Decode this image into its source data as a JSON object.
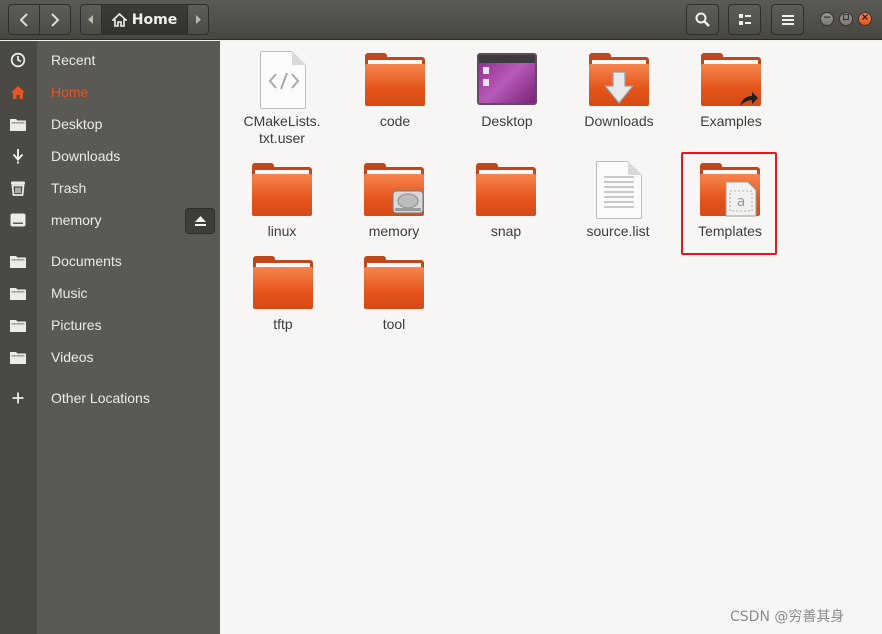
{
  "header": {
    "back_icon": "chevron-left-icon",
    "forward_icon": "chevron-right-icon",
    "path_label": "Home",
    "search_icon": "search-icon",
    "view_icon": "grid-view-icon",
    "menu_icon": "hamburger-menu-icon"
  },
  "sidebar": {
    "items": [
      {
        "label": "Recent",
        "icon": "clock-icon"
      },
      {
        "label": "Home",
        "icon": "home-icon",
        "active": true
      },
      {
        "label": "Desktop",
        "icon": "folder-icon"
      },
      {
        "label": "Downloads",
        "icon": "download-icon"
      },
      {
        "label": "Trash",
        "icon": "trash-icon"
      },
      {
        "label": "memory",
        "icon": "drive-icon"
      },
      {
        "label": "Documents",
        "icon": "folder-icon"
      },
      {
        "label": "Music",
        "icon": "folder-icon"
      },
      {
        "label": "Pictures",
        "icon": "folder-icon"
      },
      {
        "label": "Videos",
        "icon": "folder-icon"
      },
      {
        "label": "Other Locations",
        "icon": "plus-icon"
      }
    ]
  },
  "files": [
    {
      "name": "CMakeLists.\ntxt.user",
      "kind": "code-file"
    },
    {
      "name": "code",
      "kind": "folder"
    },
    {
      "name": "Desktop",
      "kind": "desktop-folder"
    },
    {
      "name": "Downloads",
      "kind": "downloads-folder"
    },
    {
      "name": "Examples",
      "kind": "link-folder"
    },
    {
      "name": "linux",
      "kind": "folder"
    },
    {
      "name": "memory",
      "kind": "drive-folder"
    },
    {
      "name": "snap",
      "kind": "folder"
    },
    {
      "name": "source.list",
      "kind": "text-file"
    },
    {
      "name": "Templates",
      "kind": "templates-folder"
    },
    {
      "name": "tftp",
      "kind": "folder"
    },
    {
      "name": "tool",
      "kind": "folder"
    }
  ],
  "colors": {
    "accent": "#e95420",
    "highlight_box": "#e8161b"
  },
  "watermark": "CSDN @穷善其身"
}
